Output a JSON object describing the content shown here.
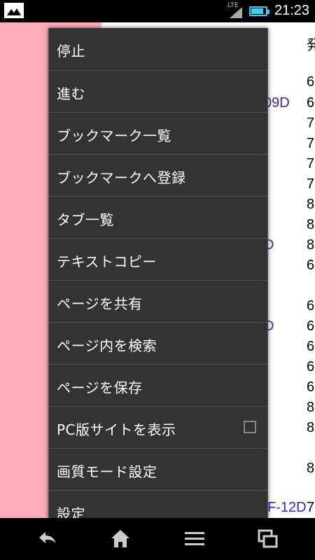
{
  "statusbar": {
    "network_label": "LTE",
    "time": "21:23",
    "battery_percent": 85
  },
  "background_page": {
    "right_column": [
      {
        "text": "発",
        "style": "plain"
      },
      {
        "text": "6",
        "style": "plain"
      },
      {
        "text": "09D",
        "style": "visited"
      },
      {
        "text": "6",
        "style": "plain"
      },
      {
        "text": "7",
        "style": "plain"
      },
      {
        "text": "7",
        "style": "plain"
      },
      {
        "text": "7",
        "style": "plain"
      },
      {
        "text": "7",
        "style": "plain"
      },
      {
        "text": "8",
        "style": "plain"
      },
      {
        "text": "8",
        "style": "plain"
      },
      {
        "text": "D",
        "style": "link"
      },
      {
        "text": "8",
        "style": "plain"
      },
      {
        "text": "6",
        "style": "plain"
      },
      {
        "text": "6",
        "style": "plain"
      },
      {
        "text": "D",
        "style": "link"
      },
      {
        "text": "6",
        "style": "plain"
      },
      {
        "text": "6",
        "style": "plain"
      },
      {
        "text": "6",
        "style": "plain"
      },
      {
        "text": "6",
        "style": "plain"
      },
      {
        "text": "8",
        "style": "plain"
      },
      {
        "text": "8",
        "style": "plain"
      },
      {
        "text": "8",
        "style": "plain"
      },
      {
        "text": "F-12D",
        "style": "link"
      },
      {
        "text": "7",
        "style": "plain"
      }
    ]
  },
  "menu": {
    "items": [
      {
        "label": "停止"
      },
      {
        "label": "進む"
      },
      {
        "label": "ブックマーク一覧"
      },
      {
        "label": "ブックマークへ登録"
      },
      {
        "label": "タブ一覧"
      },
      {
        "label": "テキストコピー"
      },
      {
        "label": "ページを共有"
      },
      {
        "label": "ページ内を検索"
      },
      {
        "label": "ページを保存"
      },
      {
        "label": "PC版サイトを表示",
        "checkbox": true,
        "checked": false
      },
      {
        "label": "画質モード設定"
      },
      {
        "label": "設定"
      }
    ]
  },
  "navbar": {
    "buttons": [
      "back-icon",
      "home-icon",
      "menu-icon",
      "recent-apps-icon"
    ]
  }
}
